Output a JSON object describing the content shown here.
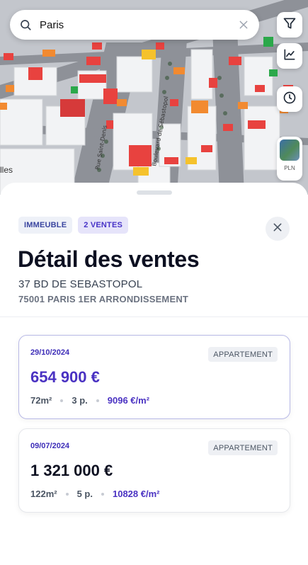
{
  "map": {
    "place_label": "lles",
    "street_labels": [
      "Boulevard de Sébastopol",
      "Rue Saint-Denis"
    ]
  },
  "search": {
    "value": "Paris",
    "search_icon": "search-icon",
    "clear_icon": "close-icon"
  },
  "map_controls": {
    "filter_icon": "filter-icon",
    "chart_icon": "chart-line-icon",
    "history_icon": "clock-icon",
    "plan_label": "PLN"
  },
  "detail": {
    "badges": [
      "IMMEUBLE",
      "2 VENTES"
    ],
    "title": "Détail des ventes",
    "address_line1": "37 BD DE SEBASTOPOL",
    "address_line2": "75001 PARIS 1ER ARRONDISSEMENT",
    "close_icon": "close-icon"
  },
  "sales": [
    {
      "date": "29/10/2024",
      "type": "APPARTEMENT",
      "price": "654 900 €",
      "price_color": "#4a32c2",
      "surface": "72m²",
      "rooms": "3 p.",
      "price_per_m2": "9096 €/m²"
    },
    {
      "date": "09/07/2024",
      "type": "APPARTEMENT",
      "price": "1 321 000 €",
      "price_color": "#0d1021",
      "surface": "122m²",
      "rooms": "5 p.",
      "price_per_m2": "10828 €/m²"
    }
  ],
  "colors": {
    "accent": "#4a32c2",
    "price_high": "#e8423f",
    "price_mid": "#f28a30",
    "price_low": "#f5c22c",
    "price_cheap": "#2ba84a"
  }
}
